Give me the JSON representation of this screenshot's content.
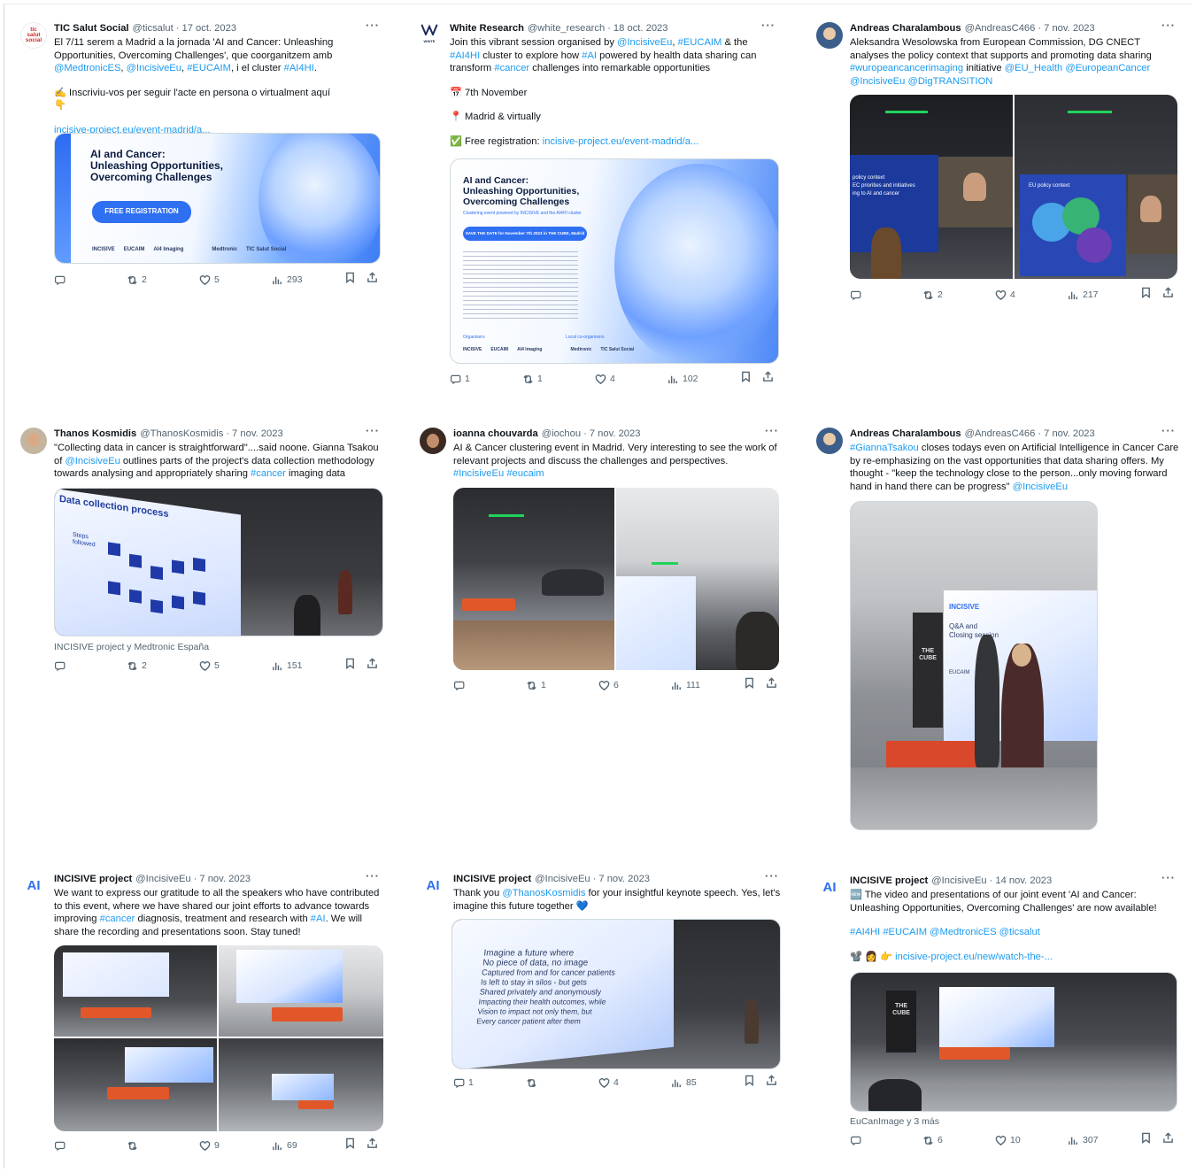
{
  "tweets": [
    {
      "name": "TIC Salut Social",
      "handle": "@ticsalut",
      "date": "17 oct. 2023",
      "avatar_text": "tic salut social",
      "text": [
        [
          {
            "t": "El 7/11 serem a Madrid a la jornada 'AI and Cancer: Unleashing Opportunities, Overcoming Challenges', que coorganitzem amb "
          },
          {
            "t": "@MedtronicES",
            "link": true
          },
          {
            "t": ", "
          },
          {
            "t": "@IncisiveEu",
            "link": true
          },
          {
            "t": ", "
          },
          {
            "t": "#EUCAIM",
            "link": true
          },
          {
            "t": ", i el cluster "
          },
          {
            "t": "#AI4HI",
            "link": true
          },
          {
            "t": "."
          }
        ],
        [
          {
            "t": "✍️ Inscriviu-vos per seguir l'acte en persona o virtualment aquí 👇"
          }
        ],
        [
          {
            "t": "incisive-project.eu/event-madrid/a...",
            "link": true
          }
        ]
      ],
      "poster": {
        "title_1": "AI and Cancer:",
        "title_2": "Unleashing Opportunities,",
        "title_3": "Overcoming Challenges",
        "button": "FREE REGISTRATION",
        "logos": [
          "INCISIVE",
          "EUCAIM",
          "AI4 Imaging",
          "Medtronic",
          "TIC Salut Social"
        ]
      },
      "stats": {
        "replies": "",
        "retweets": "2",
        "likes": "5",
        "views": "293"
      }
    },
    {
      "name": "White Research",
      "handle": "@white_research",
      "date": "18 oct. 2023",
      "avatar_text": "WHITE",
      "text": [
        [
          {
            "t": "Join this vibrant session organised by "
          },
          {
            "t": "@IncisiveEu",
            "link": true
          },
          {
            "t": ", "
          },
          {
            "t": "#EUCAIM",
            "link": true
          },
          {
            "t": " & the "
          },
          {
            "t": "#AI4HI",
            "link": true
          },
          {
            "t": " cluster to explore how "
          },
          {
            "t": "#AI",
            "link": true
          },
          {
            "t": " powered by health data sharing can transform "
          },
          {
            "t": "#cancer",
            "link": true
          },
          {
            "t": " challenges into remarkable opportunities"
          }
        ],
        [
          {
            "t": "📅 7th November"
          }
        ],
        [
          {
            "t": "📍 Madrid & virtually"
          }
        ],
        [
          {
            "t": "✅ Free registration: "
          },
          {
            "t": "incisive-project.eu/event-madrid/a...",
            "link": true
          }
        ]
      ],
      "poster": {
        "title_1": "AI and Cancer:",
        "title_2": "Unleashing Opportunities,",
        "title_3": "Overcoming Challenges",
        "subtitle": "Clustering event powered by INCISIVE and the AI4HI cluster",
        "button": "SAVE THE DATE for November 7th 2023 in THE CUBE, Madrid",
        "organisers_label": "Organisers",
        "local_label": "Local co-organisers",
        "logos": [
          "INCISIVE",
          "EUCAIM",
          "AI4 Imaging",
          "Medtronic",
          "TIC Salut Social"
        ]
      },
      "stats": {
        "replies": "1",
        "retweets": "1",
        "likes": "4",
        "views": "102"
      }
    },
    {
      "name": "Andreas Charalambous",
      "handle": "@AndreasC466",
      "date": "7 nov. 2023",
      "text": [
        [
          {
            "t": "Aleksandra Wesolowska from European Commission, DG CNECT analyses the policy context that supports and promoting data sharing "
          },
          {
            "t": "#wuropeancancerimaging",
            "link": true
          },
          {
            "t": " initiative "
          },
          {
            "t": "@EU_Health",
            "link": true
          },
          {
            "t": " "
          },
          {
            "t": "@EuropeanCancer",
            "link": true
          },
          {
            "t": " "
          },
          {
            "t": "@IncisiveEu",
            "link": true
          },
          {
            "t": " "
          },
          {
            "t": "@DigTRANSITION",
            "link": true
          }
        ]
      ],
      "slides": {
        "left": [
          "policy context",
          "EC priorities and initiatives",
          "ing to AI and cancer"
        ],
        "right": [
          "EU policy context"
        ]
      },
      "stats": {
        "replies": "",
        "retweets": "2",
        "likes": "4",
        "views": "217"
      }
    },
    {
      "name": "Thanos Kosmidis",
      "handle": "@ThanosKosmidis",
      "date": "7 nov. 2023",
      "text": [
        [
          {
            "t": "\"Collecting data in cancer is straightforward\"....said noone. Gianna Tsakou of "
          },
          {
            "t": "@IncisiveEu",
            "link": true
          },
          {
            "t": " outlines parts of the project's data collection methodology towards analysing and appropriately sharing "
          },
          {
            "t": "#cancer",
            "link": true
          },
          {
            "t": " imaging data"
          }
        ]
      ],
      "slide_title": "Data collection process",
      "slide_side": "Steps followed",
      "caption": "INCISIVE project y Medtronic España",
      "stats": {
        "replies": "",
        "retweets": "2",
        "likes": "5",
        "views": "151"
      }
    },
    {
      "name": "ioanna chouvarda",
      "handle": "@iochou",
      "date": "7 nov. 2023",
      "text": [
        [
          {
            "t": "AI & Cancer clustering event in Madrid. Very interesting to see the work of relevant projects and discuss the challenges and perspectives. "
          },
          {
            "t": "#IncisiveEu",
            "link": true
          },
          {
            "t": " "
          },
          {
            "t": "#eucaim",
            "link": true
          }
        ]
      ],
      "stats": {
        "replies": "",
        "retweets": "1",
        "likes": "6",
        "views": "111"
      }
    },
    {
      "name": "Andreas Charalambous",
      "handle": "@AndreasC466",
      "date": "7 nov. 2023",
      "text": [
        [
          {
            "t": "#GiannaTsakou",
            "link": true
          },
          {
            "t": " closes todays even on Artificial Intelligence in Cancer Care by re-emphasizing on the vast opportunities that data sharing offers. My thought - \"keep the technology close to the person...only moving forward hand in hand there can be progress\" "
          },
          {
            "t": "@IncisiveEu",
            "link": true
          }
        ]
      ],
      "screen": {
        "brand": "INCISIVE",
        "line_1": "Q&A and",
        "line_2": "Closing session",
        "cube": "THE CUBE",
        "eucaim": "EUCAIM"
      },
      "stats": {
        "replies": "",
        "retweets": "",
        "likes": "",
        "views": ""
      }
    },
    {
      "name": "INCISIVE project",
      "handle": "@IncisiveEu",
      "date": "7 nov. 2023",
      "text": [
        [
          {
            "t": "We want to express our gratitude to all the speakers who have contributed to this event, where we have shared our joint efforts to advance towards improving "
          },
          {
            "t": "#cancer",
            "link": true
          },
          {
            "t": " diagnosis, treatment and research with "
          },
          {
            "t": "#AI",
            "link": true
          },
          {
            "t": ". We will share the recording and presentations soon. Stay tuned!"
          }
        ]
      ],
      "stats": {
        "replies": "",
        "retweets": "",
        "likes": "9",
        "views": "69"
      }
    },
    {
      "name": "INCISIVE project",
      "handle": "@IncisiveEu",
      "date": "7 nov. 2023",
      "text": [
        [
          {
            "t": "Thank you "
          },
          {
            "t": "@ThanosKosmidis",
            "link": true
          },
          {
            "t": " for your insightful keynote speech. Yes, let's imagine this future together 💙"
          }
        ]
      ],
      "slide_lines": [
        "Imagine a future where",
        "No piece of data, no image",
        "Captured from and for cancer patients",
        "Is left to stay in silos - but gets",
        "Shared privately and anonymously",
        "Impacting their health outcomes, while",
        "Vision to impact not only them, but",
        "Every cancer patient after them"
      ],
      "stats": {
        "replies": "1",
        "retweets": "",
        "likes": "4",
        "views": "85"
      }
    },
    {
      "name": "INCISIVE project",
      "handle": "@IncisiveEu",
      "date": "14 nov. 2023",
      "text": [
        [
          {
            "t": "🆕 The video and presentations of our joint event 'AI and Cancer: Unleashing Opportunities, Overcoming Challenges' are now available!"
          }
        ],
        [
          {
            "t": "#AI4HI",
            "link": true
          },
          {
            "t": " "
          },
          {
            "t": "#EUCAIM",
            "link": true
          },
          {
            "t": " "
          },
          {
            "t": "@MedtronicES",
            "link": true
          },
          {
            "t": " "
          },
          {
            "t": "@ticsalut",
            "link": true
          }
        ],
        [
          {
            "t": "📽️ 👩 👉 "
          },
          {
            "t": "incisive-project.eu/new/watch-the-...",
            "link": true
          }
        ]
      ],
      "cube": "THE CUBE",
      "caption": "EuCanImage y 3 más",
      "stats": {
        "replies": "",
        "retweets": "6",
        "likes": "10",
        "views": "307"
      }
    }
  ],
  "colors": {
    "link": "#1d9bf0",
    "muted": "#536471",
    "text": "#0f1419",
    "accent_blue": "#2f6ff2",
    "sofa": "#e2572a"
  },
  "icons": [
    "reply-icon",
    "retweet-icon",
    "like-icon",
    "views-icon",
    "bookmark-icon",
    "share-icon",
    "more-icon"
  ]
}
